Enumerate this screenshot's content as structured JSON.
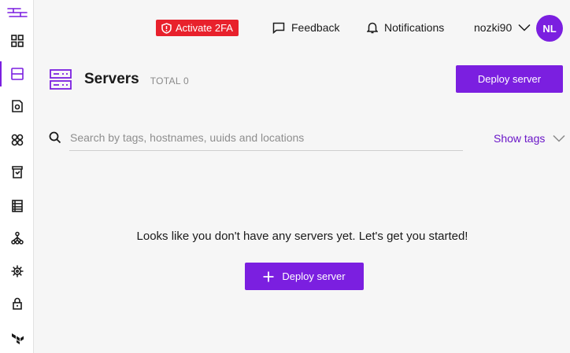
{
  "colors": {
    "accent": "#7b1fe0",
    "danger": "#e8212c",
    "link": "#6a16c8"
  },
  "sidebar": {
    "items": [
      {
        "icon": "grid-icon"
      },
      {
        "icon": "servers-icon",
        "active": true
      },
      {
        "icon": "storage-icon"
      },
      {
        "icon": "clusters-icon"
      },
      {
        "icon": "backup-icon"
      },
      {
        "icon": "database-icon"
      },
      {
        "icon": "network-icon"
      },
      {
        "icon": "kubernetes-icon"
      },
      {
        "icon": "lock-icon"
      },
      {
        "icon": "terraform-icon"
      }
    ]
  },
  "topbar": {
    "activate_2fa": "Activate 2FA",
    "feedback": "Feedback",
    "notifications": "Notifications",
    "username": "nozki90",
    "avatar_initials": "NL"
  },
  "page": {
    "title": "Servers",
    "total": "TOTAL 0",
    "deploy_button": "Deploy server"
  },
  "search": {
    "placeholder": "Search by tags, hostnames, uuids and locations",
    "value": "",
    "show_tags": "Show tags"
  },
  "empty_state": {
    "message": "Looks like you don't have any servers yet. Let's get you started!",
    "deploy_button": "Deploy server"
  }
}
